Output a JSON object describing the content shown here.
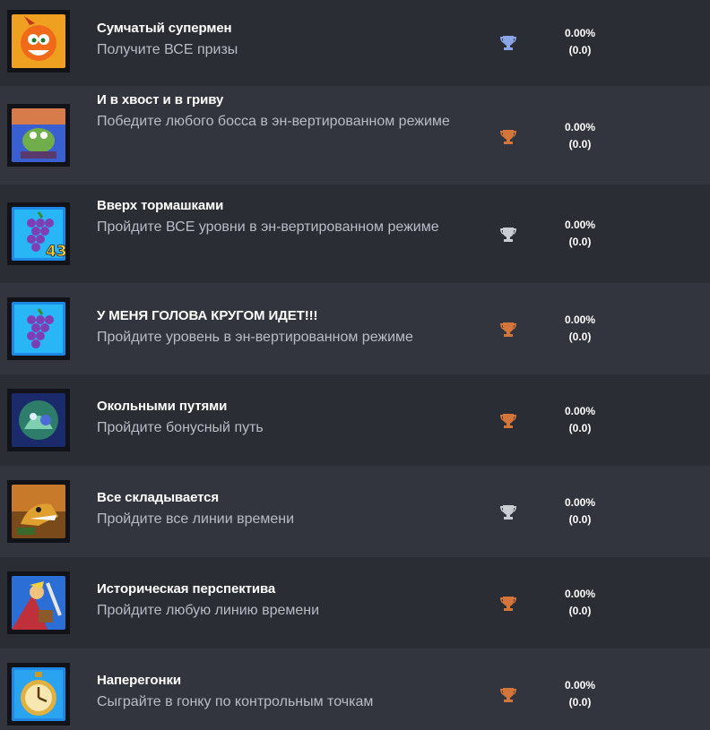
{
  "colors": {
    "row_odd": "#2b2d35",
    "row_even": "#32353e",
    "trophy_platinum": "#8aa6e6",
    "trophy_gold_bronze": "#d4763a",
    "trophy_silver": "#c9ccd2"
  },
  "achievements": [
    {
      "title": "Сумчатый супермен",
      "desc": "Получите ВСЕ призы",
      "trophy": "platinum-trophy-icon",
      "percent": "0.00%",
      "score": "(0.0)",
      "art": "crash-icon"
    },
    {
      "title": "И в хвост и в гриву",
      "desc": "Победите любого босса в эн-вертированном режиме",
      "trophy": "bronze-trophy-icon",
      "percent": "0.00%",
      "score": "(0.0)",
      "art": "boss-icon"
    },
    {
      "title": "Вверх тормашками",
      "desc": "Пройдите ВСЕ уровни в эн-вертированном режиме",
      "trophy": "silver-trophy-icon",
      "percent": "0.00%",
      "score": "(0.0)",
      "art": "grapes-43-icon",
      "badge": "43"
    },
    {
      "title": "У МЕНЯ ГОЛОВА КРУГОМ ИДЕТ!!!",
      "desc": "Пройдите уровень в эн-вертированном режиме",
      "trophy": "bronze-trophy-icon",
      "percent": "0.00%",
      "score": "(0.0)",
      "art": "grapes-icon"
    },
    {
      "title": "Окольными путями",
      "desc": "Пройдите бонусный путь",
      "trophy": "bronze-trophy-icon",
      "percent": "0.00%",
      "score": "(0.0)",
      "art": "bonus-path-icon"
    },
    {
      "title": "Все складывается",
      "desc": "Пройдите все линии времени",
      "trophy": "silver-trophy-icon",
      "percent": "0.00%",
      "score": "(0.0)",
      "art": "dingodile-icon"
    },
    {
      "title": "Историческая перспектива",
      "desc": "Пройдите любую линию времени",
      "trophy": "bronze-trophy-icon",
      "percent": "0.00%",
      "score": "(0.0)",
      "art": "hero-icon"
    },
    {
      "title": "Наперегонки",
      "desc": "Сыграйте в гонку по контрольным точкам",
      "trophy": "bronze-trophy-icon",
      "percent": "0.00%",
      "score": "(0.0)",
      "art": "stopwatch-icon"
    }
  ]
}
